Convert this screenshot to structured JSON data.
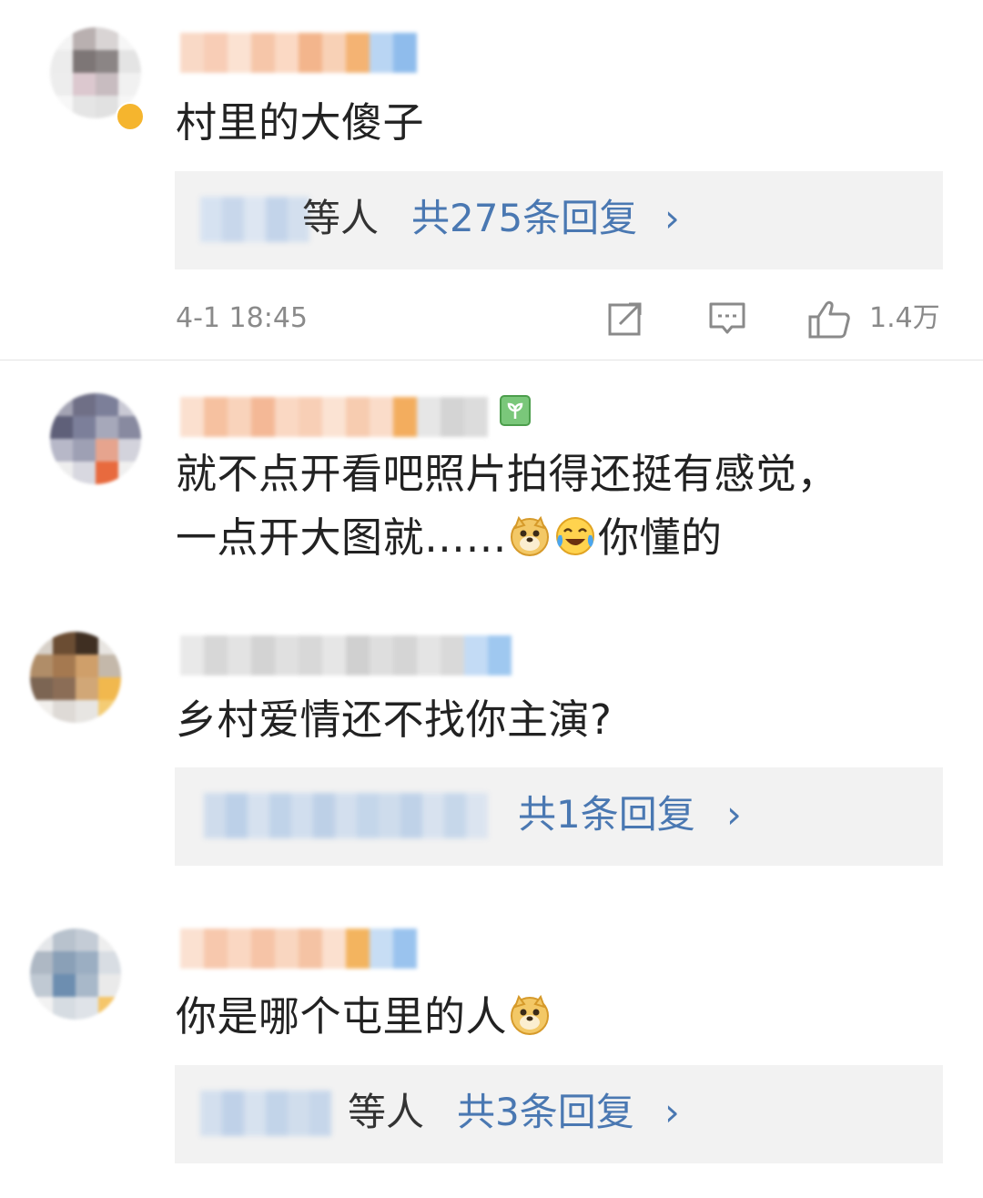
{
  "comments": [
    {
      "text": "村里的大傻子",
      "reply": {
        "suffix": "等人",
        "count_label": "共275条回复",
        "chevron": "›"
      },
      "time": "4-1  18:45",
      "likes": "1.4万",
      "actions": [
        "share-icon",
        "comment-icon",
        "like-icon"
      ]
    },
    {
      "text_line1": "就不点开看吧照片拍得还挺有感觉，",
      "text_line2_before": "一点开大图就……",
      "text_line2_after": "你懂的",
      "emojis": [
        "doge-emoji",
        "laugh-cry-emoji"
      ]
    },
    {
      "text": "乡村爱情还不找你主演?",
      "reply": {
        "count_label": "共1条回复",
        "chevron": "›"
      }
    },
    {
      "text": "你是哪个屯里的人",
      "emojis": [
        "doge-emoji"
      ],
      "reply": {
        "suffix": "等人",
        "count_label": "共3条回复",
        "chevron": "›"
      }
    }
  ],
  "colors": {
    "reply_link": "#4a78b2",
    "reply_bg": "#f2f2f2",
    "meta_gray": "#8a8a8a",
    "divider": "#e4e4e4"
  }
}
